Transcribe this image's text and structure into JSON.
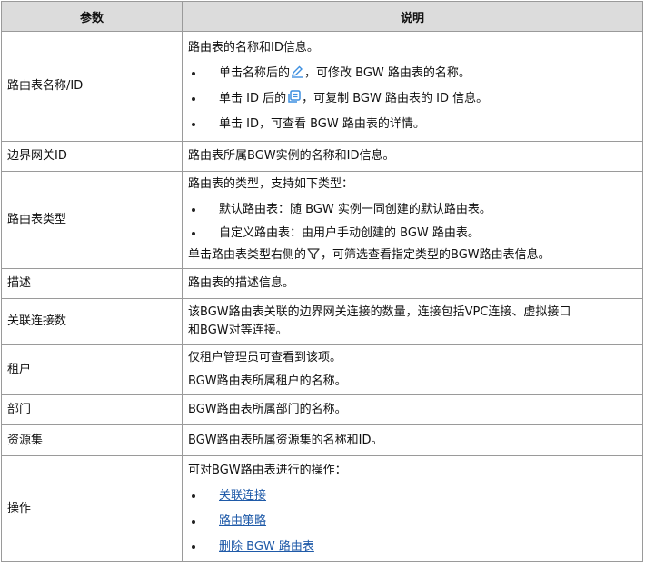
{
  "header": {
    "param": "参数",
    "desc": "说明"
  },
  "rows": {
    "name_id": {
      "param": "路由表名称/ID",
      "intro": "路由表的名称和ID信息。",
      "b1_pre": "单击名称后的",
      "b1_post": "，可修改 BGW 路由表的名称。",
      "b2_pre": "单击 ID 后的",
      "b2_post": "，可复制 BGW 路由表的 ID 信息。",
      "b3": "单击 ID，可查看 BGW 路由表的详情。"
    },
    "gateway": {
      "param": "边界网关ID",
      "desc": "路由表所属BGW实例的名称和ID信息。"
    },
    "type": {
      "param": "路由表类型",
      "intro": "路由表的类型，支持如下类型：",
      "b1": "默认路由表：随 BGW 实例一同创建的默认路由表。",
      "b2": "自定义路由表：由用户手动创建的 BGW 路由表。",
      "note_pre": "单击路由表类型右侧的",
      "note_post": "，可筛选查看指定类型的BGW路由表信息。"
    },
    "description": {
      "param": "描述",
      "desc": "路由表的描述信息。"
    },
    "connections": {
      "param": "关联连接数",
      "line1": "该BGW路由表关联的边界网关连接的数量，连接包括VPC连接、虚拟接口",
      "line2": "和BGW对等连接。"
    },
    "tenant": {
      "param": "租户",
      "line1": "仅租户管理员可查看到该项。",
      "line2": "BGW路由表所属租户的名称。"
    },
    "department": {
      "param": "部门",
      "desc": "BGW路由表所属部门的名称。"
    },
    "resource_set": {
      "param": "资源集",
      "desc": "BGW路由表所属资源集的名称和ID。"
    },
    "operation": {
      "param": "操作",
      "intro": "可对BGW路由表进行的操作：",
      "links": [
        "关联连接",
        "路由策略",
        "删除 BGW 路由表"
      ]
    }
  },
  "icons": {
    "edit": "edit-icon",
    "copy": "copy-icon",
    "filter": "filter-icon",
    "icon_color": "#3d8fe0"
  }
}
